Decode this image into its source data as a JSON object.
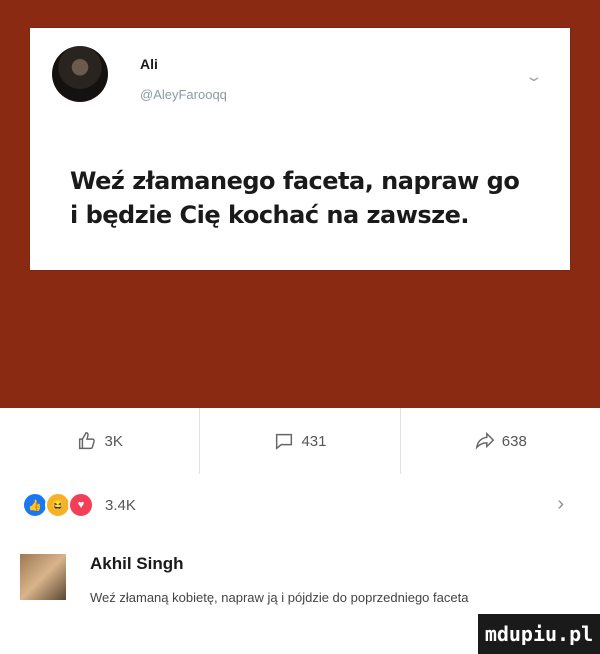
{
  "tweet": {
    "author_name": "Ali",
    "author_handle": "@AleyFarooqq",
    "text": "Weź złamanego faceta, napraw go i będzie Cię kochać na zawsze."
  },
  "actions": {
    "like_count": "3K",
    "comment_count": "431",
    "share_count": "638"
  },
  "reactions": {
    "total": "3.4K"
  },
  "comment": {
    "author": "Akhil Singh",
    "text": "Weź złamaną kobietę, napraw ją i pójdzie do poprzedniego faceta"
  },
  "watermark": "mdupiu.pl",
  "colors": {
    "banner": "#8a2a12",
    "like_blue": "#1877f2",
    "love_red": "#f33e58",
    "haha_yellow": "#f7b125"
  }
}
